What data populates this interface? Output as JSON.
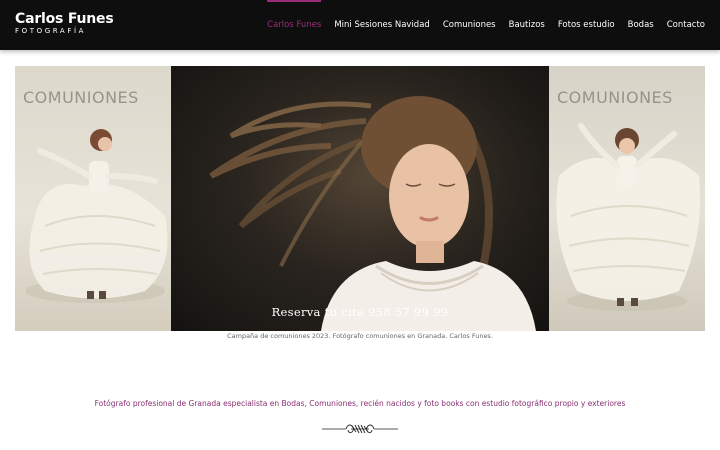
{
  "header": {
    "logo": {
      "name": "Carlos Funes",
      "subtitle": "FOTOGRAFÍA"
    },
    "nav": [
      {
        "label": "Carlos Funes",
        "active": true
      },
      {
        "label": "Mini Sesiones Navidad",
        "active": false
      },
      {
        "label": "Comuniones",
        "active": false
      },
      {
        "label": "Bautizos",
        "active": false
      },
      {
        "label": "Fotos estudio",
        "active": false
      },
      {
        "label": "Bodas",
        "active": false
      },
      {
        "label": "Contacto",
        "active": false
      }
    ],
    "accent_color": "#9b2c78"
  },
  "hero": {
    "left_panel_text": "COMUNIONES",
    "right_panel_text": "COMUNIONES",
    "overlay_text": "Reserva tu cita  958 57 99 99"
  },
  "caption": "Campaña de comuniones 2023. Fotógrafo comuniones en Granada. Carlos Funes.",
  "tagline": "Fotógrafo profesional de Granada especialista en Bodas, Comuniones, recién nacidos y foto books con estudio fotográfico propio y exteriores",
  "ornament_icon": "flourish-divider-icon"
}
